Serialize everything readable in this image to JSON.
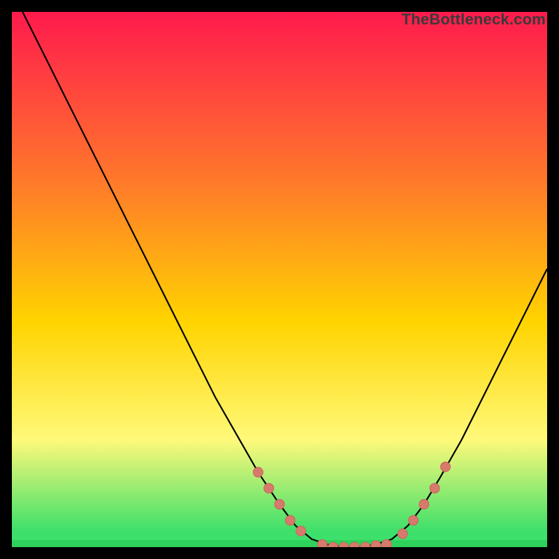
{
  "watermark": "TheBottleneck.com",
  "colors": {
    "black": "#000000",
    "curve": "#000000",
    "marker_fill": "#d7796d",
    "marker_stroke": "#c96558",
    "grad_top": "#ff1a4d",
    "grad_mid1": "#ff7a2a",
    "grad_mid2": "#ffd400",
    "grad_mid3": "#fff97a",
    "grad_bottom": "#3de06a",
    "bottom_band": "#2ed15a"
  },
  "chart_data": {
    "type": "line",
    "title": "",
    "xlabel": "",
    "ylabel": "",
    "xlim": [
      0,
      100
    ],
    "ylim": [
      0,
      100
    ],
    "series": [
      {
        "name": "bottleneck-curve",
        "x": [
          2,
          6,
          10,
          14,
          18,
          22,
          26,
          30,
          34,
          38,
          42,
          46,
          50,
          53,
          56,
          59,
          62,
          65,
          68,
          71,
          74,
          77,
          80,
          84,
          88,
          92,
          96,
          100
        ],
        "y": [
          100,
          92,
          84,
          76,
          68,
          60,
          52,
          44,
          36,
          28,
          21,
          14,
          8,
          4,
          1.5,
          0.5,
          0,
          0,
          0.5,
          1.5,
          4,
          8,
          13,
          20,
          28,
          36,
          44,
          52
        ]
      }
    ],
    "markers": [
      {
        "x": 46,
        "y": 14
      },
      {
        "x": 48,
        "y": 11
      },
      {
        "x": 50,
        "y": 8
      },
      {
        "x": 52,
        "y": 5
      },
      {
        "x": 54,
        "y": 3
      },
      {
        "x": 58,
        "y": 0.5
      },
      {
        "x": 60,
        "y": 0
      },
      {
        "x": 62,
        "y": 0
      },
      {
        "x": 64,
        "y": 0
      },
      {
        "x": 66,
        "y": 0
      },
      {
        "x": 68,
        "y": 0.3
      },
      {
        "x": 70,
        "y": 0.5
      },
      {
        "x": 73,
        "y": 2.5
      },
      {
        "x": 75,
        "y": 5
      },
      {
        "x": 77,
        "y": 8
      },
      {
        "x": 79,
        "y": 11
      },
      {
        "x": 81,
        "y": 15
      }
    ]
  }
}
